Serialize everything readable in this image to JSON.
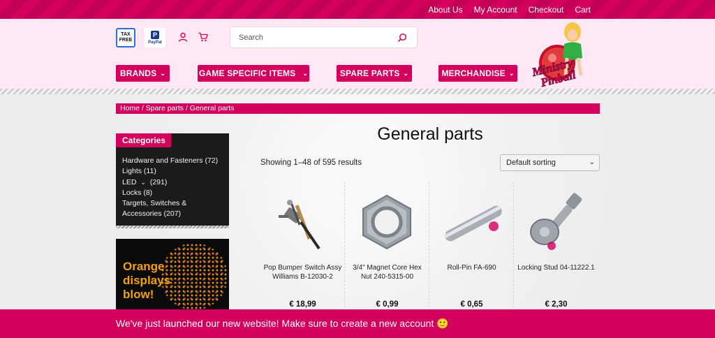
{
  "top_nav": {
    "links": [
      "About Us",
      "My Account",
      "Checkout",
      "Cart"
    ]
  },
  "header": {
    "badges": {
      "tax_free_line1": "TAX",
      "tax_free_line2": "FREE",
      "paypal": "PayPal"
    },
    "search": {
      "placeholder": "Search",
      "value": ""
    },
    "logo_text_1": "Ministry",
    "logo_text_2": "Pinball"
  },
  "main_nav": [
    {
      "label": "BRANDS"
    },
    {
      "label": "GAME SPECIFIC ITEMS"
    },
    {
      "label": "SPARE PARTS"
    },
    {
      "label": "MERCHANDISE"
    }
  ],
  "breadcrumb": "Home / Spare parts / General parts",
  "sidebar": {
    "title": "Categories",
    "categories": [
      {
        "label": "Hardware and Fasteners (72)"
      },
      {
        "label": "Lights (11)"
      },
      {
        "label": "LED",
        "count": "(291)"
      },
      {
        "label": "Locks (8)"
      },
      {
        "label": "Targets, Switches & Accessories (207)"
      }
    ],
    "promo_lines": [
      "Orange",
      "displays",
      "blow!"
    ]
  },
  "main": {
    "title": "General parts",
    "result_count": "Showing 1–48 of 595 results",
    "sort_selected": "Default sorting",
    "products": [
      {
        "name": "Pop Bumper Switch Assy Williams B-12030-2",
        "price": "€ 18,99",
        "icon": "pop-bumper-switch"
      },
      {
        "name": "3/4\" Magnet Core Hex Nut 240-5315-00",
        "price": "€ 0,99",
        "icon": "hex-nut"
      },
      {
        "name": "Roll-Pin FA-690",
        "price": "€ 0,65",
        "icon": "roll-pin"
      },
      {
        "name": "Locking Stud 04-11222.1",
        "price": "€ 2,30",
        "icon": "locking-stud"
      }
    ]
  },
  "notice": "We've just launched our new website! Make sure to create a new account 🙂",
  "colors": {
    "brand": "#d4005e",
    "header_bg": "#fde8f3",
    "sidebar_bg": "#1b1b1b"
  }
}
